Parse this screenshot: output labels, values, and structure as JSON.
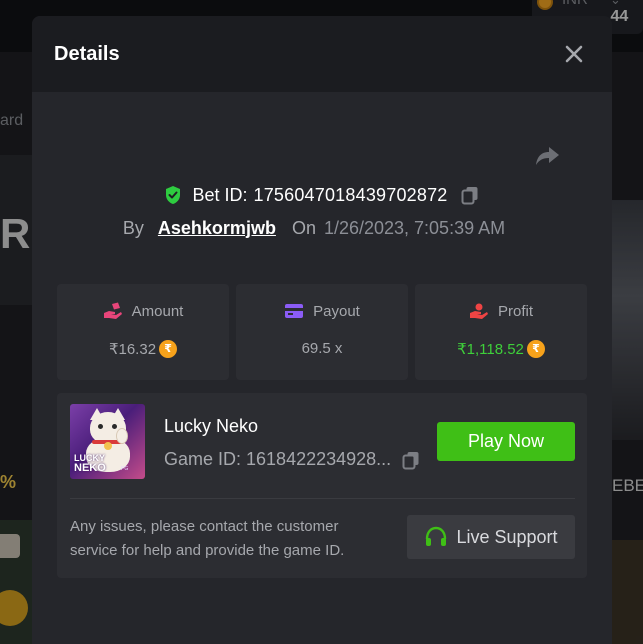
{
  "background": {
    "currency": "INR",
    "balance_fragment": ".44",
    "left_text_fragment": "ard",
    "hero_fragment": "R",
    "pct_fragment": "%",
    "right_text_fragment": "EBE"
  },
  "modal": {
    "title": "Details",
    "bet": {
      "label": "Bet ID:",
      "id": "1756047018439702872"
    },
    "by": {
      "by_label": "By",
      "username": "Asehkormjwb",
      "on_label": "On",
      "datetime": "1/26/2023, 7:05:39 AM"
    },
    "stats": [
      {
        "title": "Amount",
        "value": "₹16.32",
        "icon": "hand-coin-icon",
        "has_coin": true,
        "value_color": "#a6a8ad"
      },
      {
        "title": "Payout",
        "value": "69.5 x",
        "icon": "card-icon",
        "has_coin": false,
        "value_color": "#a6a8ad"
      },
      {
        "title": "Profit",
        "value": "₹1,118.52",
        "icon": "profit-hand-icon",
        "has_coin": true,
        "value_color": "#3ecf3a"
      }
    ],
    "coin_symbol": "₹",
    "game": {
      "name": "Lucky Neko",
      "id_text": "Game ID: 1618422234928...",
      "thumb_line1": "LUCKY",
      "thumb_line2": "NEKO",
      "thumb_line3": "PG",
      "play_label": "Play Now",
      "help_text": "Any issues, please contact the customer service for help and provide the game ID.",
      "support_label": "Live Support"
    }
  },
  "colors": {
    "accent_green": "#3fbf16",
    "profit_green": "#3ecf3a",
    "coin_orange": "#f7a21b",
    "amount_icon": "#e8457a",
    "payout_icon": "#8b5cf6",
    "profit_icon": "#ef4444",
    "shield_green": "#2ecc40"
  }
}
